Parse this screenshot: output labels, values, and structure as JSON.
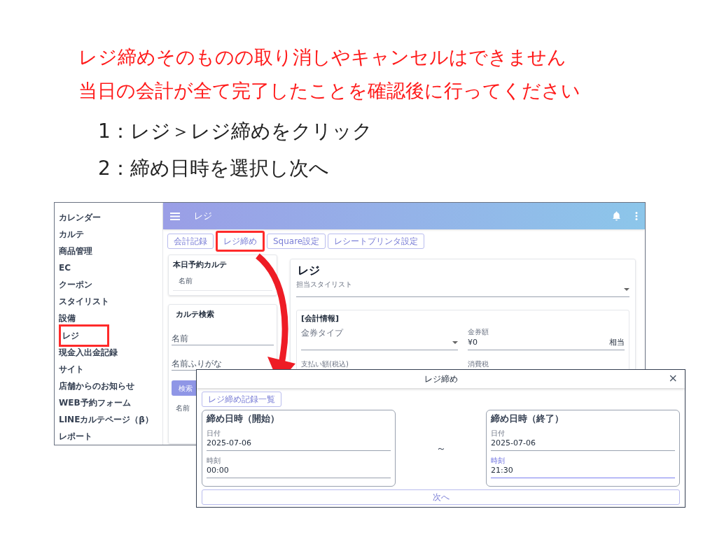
{
  "notice": [
    "レジ締めそのものの取り消しやキャンセルはできません",
    "当日の会計が全て完了したことを確認後に行ってください"
  ],
  "steps": [
    "1：レジ＞レジ締めをクリック",
    "2：締め日時を選択し次へ"
  ],
  "sidebar": {
    "items": [
      {
        "label": "カレンダー",
        "highlighted": false
      },
      {
        "label": "カルテ",
        "highlighted": false
      },
      {
        "label": "商品管理",
        "highlighted": false
      },
      {
        "label": "EC",
        "highlighted": false
      },
      {
        "label": "クーポン",
        "highlighted": false
      },
      {
        "label": "スタイリスト",
        "highlighted": false
      },
      {
        "label": "設備",
        "highlighted": false
      },
      {
        "label": "レジ",
        "highlighted": true
      },
      {
        "label": "現金入出金記録",
        "highlighted": false
      },
      {
        "label": "サイト",
        "highlighted": false
      },
      {
        "label": "店舗からのお知らせ",
        "highlighted": false
      },
      {
        "label": "WEB予約フォーム",
        "highlighted": false
      },
      {
        "label": "LINEカルテページ（β）",
        "highlighted": false
      },
      {
        "label": "レポート",
        "highlighted": false
      }
    ]
  },
  "app_bar": {
    "title": "レジ"
  },
  "tabs": [
    {
      "label": "会計記録",
      "highlighted": false
    },
    {
      "label": "レジ締め",
      "highlighted": true
    },
    {
      "label": "Square設定",
      "highlighted": false
    },
    {
      "label": "レシートプリンタ設定",
      "highlighted": false
    }
  ],
  "today_card": {
    "title": "本日予約カルテ",
    "column": "名前"
  },
  "search_card": {
    "title": "カルテ検索",
    "fields": [
      {
        "placeholder": "名前"
      },
      {
        "placeholder": "名前ふりがな"
      }
    ],
    "button": "検索",
    "column": "名前"
  },
  "register": {
    "title": "レジ",
    "stylist_label": "担当スタイリスト",
    "section_title": "[会計情報]",
    "fields": [
      {
        "label": "金券タイプ",
        "kind": "select"
      },
      {
        "label": "金券額",
        "kind": "amount",
        "value": "¥0",
        "suffix": "相当"
      },
      {
        "label": "支払い額(税込)",
        "kind": "label"
      },
      {
        "label": "消費税",
        "kind": "label"
      }
    ]
  },
  "dialog": {
    "title": "レジ締め",
    "close": "×",
    "list_button": "レジ締め記録一覧",
    "separator": "～",
    "next_button": "次へ",
    "panels": [
      {
        "title": "締め日時（開始）",
        "fields": [
          {
            "label": "日付",
            "value": "2025-07-06",
            "focused": false
          },
          {
            "label": "時刻",
            "value": "00:00",
            "focused": false
          }
        ]
      },
      {
        "title": "締め日時（終了）",
        "fields": [
          {
            "label": "日付",
            "value": "2025-07-06",
            "focused": false
          },
          {
            "label": "時刻",
            "value": "21:30",
            "focused": true
          }
        ]
      }
    ]
  }
}
